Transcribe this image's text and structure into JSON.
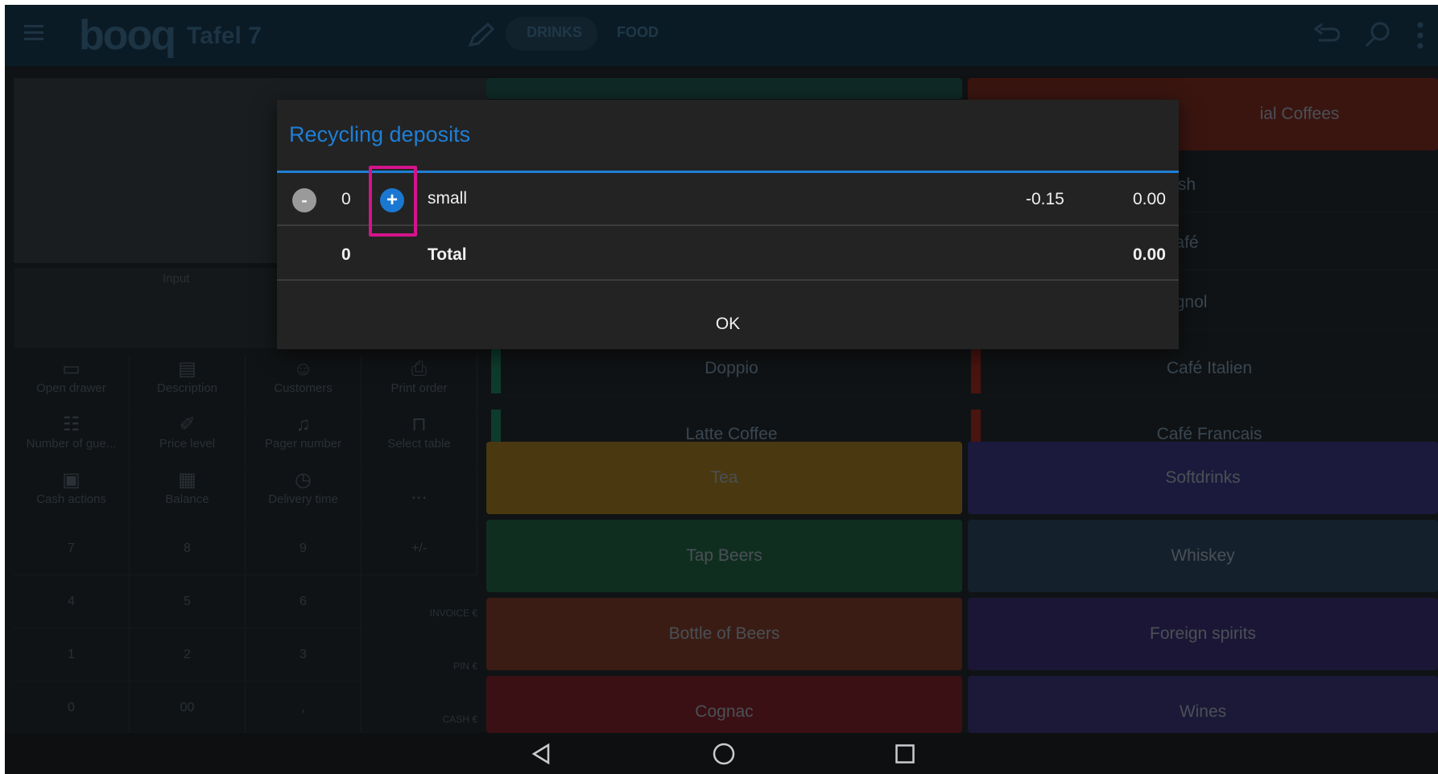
{
  "topbar": {
    "logo": "booq",
    "table_title": "Tafel 7",
    "tabs": [
      {
        "label": "DRINKS",
        "active": true
      },
      {
        "label": "FOOD",
        "active": false
      }
    ]
  },
  "left_panel": {
    "input_label": "Input",
    "actions": [
      {
        "label": "Open drawer",
        "icon": "drawer-icon"
      },
      {
        "label": "Description",
        "icon": "message-icon"
      },
      {
        "label": "Customers",
        "icon": "person-icon"
      },
      {
        "label": "Print order",
        "icon": "printer-icon"
      },
      {
        "label": "Number of gue...",
        "icon": "group-icon"
      },
      {
        "label": "Price level",
        "icon": "tag-icon"
      },
      {
        "label": "Pager number",
        "icon": "bell-icon"
      },
      {
        "label": "Select table",
        "icon": "chair-icon"
      },
      {
        "label": "Cash actions",
        "icon": "cash-register-icon"
      },
      {
        "label": "Balance",
        "icon": "receipt-icon"
      },
      {
        "label": "Delivery time",
        "icon": "clock-icon"
      },
      {
        "label": "...",
        "icon": "more-icon"
      }
    ],
    "keypad": [
      "7",
      "8",
      "9",
      "+/-",
      "4",
      "5",
      "6",
      "1",
      "2",
      "3",
      "0",
      "00",
      ","
    ],
    "payments": [
      "INVOICE €",
      "PIN €",
      "CASH €"
    ]
  },
  "products": {
    "coffee_list": [
      "Doppio",
      "Latte Coffee"
    ],
    "special_coffees": [
      "ial Coffees",
      "Café Rish",
      "Bête. Café",
      "fé Espagnol",
      "Café Italien",
      "Café Francais"
    ],
    "categories": [
      {
        "label": "Tea",
        "color": "#5a4210"
      },
      {
        "label": "Softdrinks",
        "color": "#201c4a"
      },
      {
        "label": "Tap Beers",
        "color": "#123a26"
      },
      {
        "label": "Whiskey",
        "color": "#162536"
      },
      {
        "label": "Bottle of Beers",
        "color": "#4a2418"
      },
      {
        "label": "Foreign spirits",
        "color": "#231a40"
      },
      {
        "label": "Cognac",
        "color": "#4a1418"
      },
      {
        "label": "Wines",
        "color": "#231c44"
      }
    ]
  },
  "dialog": {
    "title": "Recycling deposits",
    "item": {
      "minus": "-",
      "quantity": "0",
      "plus": "+",
      "name": "small",
      "price": "-0.15",
      "amount": "0.00"
    },
    "total": {
      "quantity": "0",
      "label": "Total",
      "amount": "0.00"
    },
    "ok_label": "OK",
    "accent_color": "#1e7fd6",
    "highlight_color": "#d4148a"
  }
}
